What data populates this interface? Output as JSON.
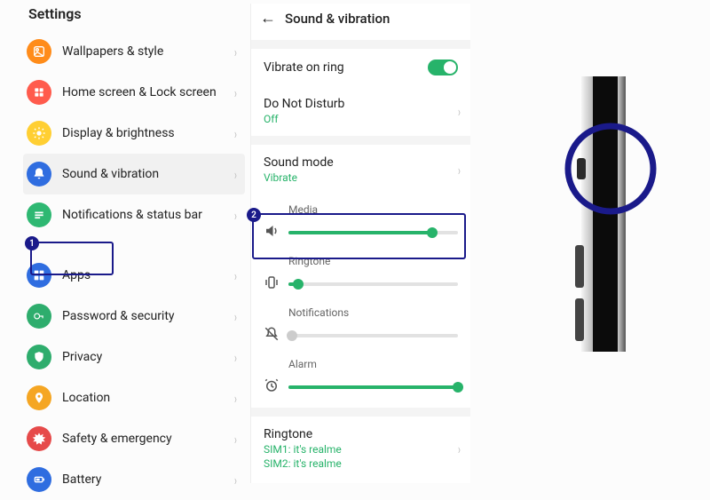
{
  "settings": {
    "title": "Settings",
    "items": [
      {
        "label": "Wallpapers & style"
      },
      {
        "label": "Home screen & Lock screen"
      },
      {
        "label": "Display & brightness"
      },
      {
        "label": "Sound & vibration"
      },
      {
        "label": "Notifications & status bar"
      },
      {
        "label": "Apps"
      },
      {
        "label": "Password & security"
      },
      {
        "label": "Privacy"
      },
      {
        "label": "Location"
      },
      {
        "label": "Safety & emergency"
      },
      {
        "label": "Battery"
      }
    ]
  },
  "sound": {
    "title": "Sound & vibration",
    "vibrate_on_ring": "Vibrate on ring",
    "dnd": "Do Not Disturb",
    "dnd_status": "Off",
    "sound_mode": "Sound mode",
    "sound_mode_status": "Vibrate",
    "sliders": {
      "media": "Media",
      "ringtone": "Ringtone",
      "notifications": "Notifications",
      "alarm": "Alarm",
      "media_pct": 85,
      "ringtone_pct": 6,
      "notifications_pct": 2,
      "alarm_pct": 100
    },
    "ringtone_section": "Ringtone",
    "ringtone_sim1": "SIM1: it's realme",
    "ringtone_sim2": "SIM2: it's realme"
  },
  "badges": {
    "one": "1",
    "two": "2"
  }
}
